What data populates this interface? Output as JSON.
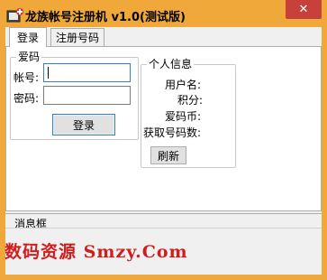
{
  "window": {
    "title": "龙族帐号注册机 v1.0(测试版)",
    "close_glyph": "✕",
    "icon": "app-icon",
    "accent_color": "#f0a83a"
  },
  "tabs": [
    {
      "label": "登录",
      "active": true
    },
    {
      "label": "注册号码",
      "active": false
    }
  ],
  "login_group": {
    "legend": "爱码",
    "account_label": "帐号:",
    "password_label": "密码:",
    "account_value": "",
    "password_value": "",
    "login_button": "登录"
  },
  "info_group": {
    "legend": "个人信息",
    "fields": [
      {
        "label": "用户名:"
      },
      {
        "label": "积分:"
      },
      {
        "label": "爱码币:"
      },
      {
        "label": "获取号码数:"
      }
    ],
    "refresh_button": "刷新"
  },
  "message": {
    "label": "消息框"
  },
  "watermark": {
    "text": "数码资源 Smzy.Com",
    "color": "#d11d1d"
  }
}
